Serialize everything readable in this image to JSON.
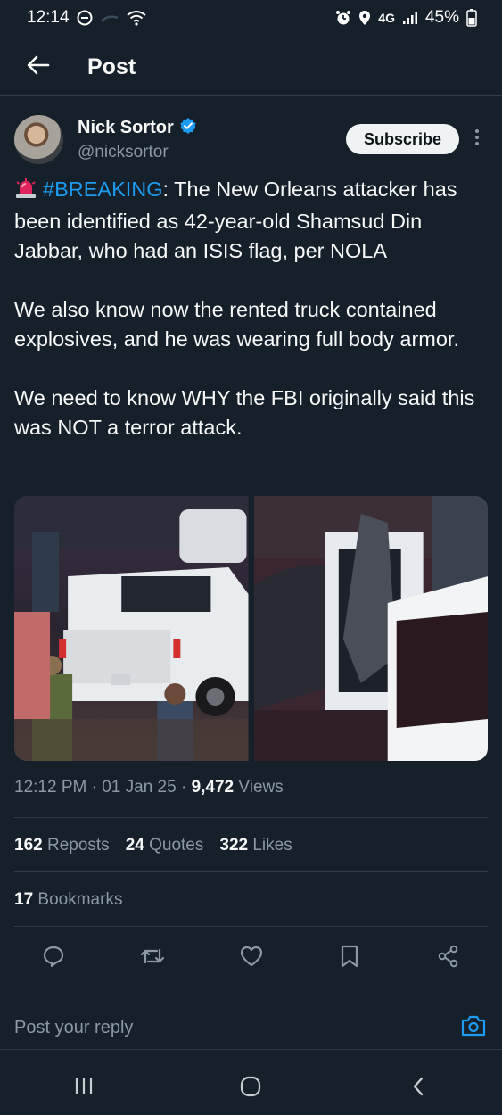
{
  "status_bar": {
    "time": "12:14",
    "network": "4G",
    "battery": "45%",
    "icons": [
      "do-not-disturb-icon",
      "signal-icon",
      "wifi-icon",
      "alarm-icon",
      "location-icon",
      "cell-signal-icon",
      "battery-icon"
    ]
  },
  "header": {
    "title": "Post",
    "back_icon": "arrow-left-icon"
  },
  "author": {
    "name": "Nick Sortor",
    "handle": "@nicksortor",
    "verified": true,
    "subscribe_label": "Subscribe"
  },
  "tweet": {
    "emoji": "siren-icon",
    "hashtag": "#BREAKING",
    "line1_rest": ": The New Orleans attacker has been identified as 42-year-old Shamsud Din Jabbar, who had an ISIS flag, per NOLA",
    "paragraph2": "We also know now the rented truck contained explosives, and he was wearing full body armor.",
    "paragraph3": "We need to know WHY the FBI originally said this was NOT a terror attack."
  },
  "meta": {
    "time": "12:12 PM",
    "date": "01 Jan 25",
    "views_count": "9,472",
    "views_label": "Views"
  },
  "stats": {
    "reposts_count": "162",
    "reposts_label": "Reposts",
    "quotes_count": "24",
    "quotes_label": "Quotes",
    "likes_count": "322",
    "likes_label": "Likes",
    "bookmarks_count": "17",
    "bookmarks_label": "Bookmarks"
  },
  "reply": {
    "placeholder": "Post your reply"
  },
  "colors": {
    "background": "#15202b",
    "accent": "#1d9bf0",
    "muted": "#8b98a5"
  }
}
